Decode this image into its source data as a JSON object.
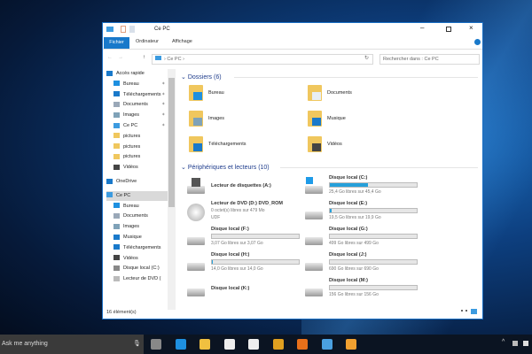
{
  "window": {
    "title": "Ce PC",
    "tabs": [
      "Fichier",
      "Ordinateur",
      "Affichage"
    ],
    "address": "Ce PC",
    "search_placeholder": "Rechercher dans : Ce PC",
    "status": "16 élément(s)"
  },
  "sidebar": [
    {
      "label": "Accès rapide",
      "icon": "star-icon",
      "color": "#1979ca",
      "indent": 0
    },
    {
      "label": "Bureau",
      "icon": "desktop-icon",
      "color": "#1e90e0",
      "indent": 1,
      "pin": true
    },
    {
      "label": "Téléchargements",
      "icon": "download-icon",
      "color": "#1979ca",
      "indent": 1,
      "pin": true
    },
    {
      "label": "Documents",
      "icon": "document-icon",
      "color": "#9aa8b8",
      "indent": 1,
      "pin": true
    },
    {
      "label": "Images",
      "icon": "image-icon",
      "color": "#7fa2b8",
      "indent": 1,
      "pin": true
    },
    {
      "label": "Ce PC",
      "icon": "computer-icon",
      "color": "#3c9be0",
      "indent": 1,
      "pin": true
    },
    {
      "label": "pictures",
      "icon": "folder-icon",
      "color": "#f0c75e",
      "indent": 1
    },
    {
      "label": "pictures",
      "icon": "folder-icon",
      "color": "#f0c75e",
      "indent": 1
    },
    {
      "label": "pictures",
      "icon": "folder-icon",
      "color": "#f0c75e",
      "indent": 1
    },
    {
      "label": "Vidéos",
      "icon": "video-icon",
      "color": "#444",
      "indent": 1
    },
    {
      "label": "OneDrive",
      "icon": "cloud-icon",
      "color": "#1979ca",
      "indent": 0,
      "gap": true
    },
    {
      "label": "Ce PC",
      "icon": "computer-icon",
      "color": "#3c9be0",
      "indent": 0,
      "gap": true,
      "selected": true
    },
    {
      "label": "Bureau",
      "icon": "desktop-icon",
      "color": "#1e90e0",
      "indent": 1
    },
    {
      "label": "Documents",
      "icon": "document-icon",
      "color": "#9aa8b8",
      "indent": 1
    },
    {
      "label": "Images",
      "icon": "image-icon",
      "color": "#7fa2b8",
      "indent": 1
    },
    {
      "label": "Musique",
      "icon": "music-icon",
      "color": "#1979ca",
      "indent": 1
    },
    {
      "label": "Téléchargements",
      "icon": "download-icon",
      "color": "#1979ca",
      "indent": 1
    },
    {
      "label": "Vidéos",
      "icon": "video-icon",
      "color": "#444",
      "indent": 1
    },
    {
      "label": "Disque local (C:)",
      "icon": "drive-icon",
      "color": "#888",
      "indent": 1
    },
    {
      "label": "Lecteur de DVD (",
      "icon": "dvd-icon",
      "color": "#bbb",
      "indent": 1
    }
  ],
  "folders": {
    "header": "Dossiers (6)",
    "items": [
      {
        "label": "Bureau",
        "accent": "#1e90e0"
      },
      {
        "label": "Documents",
        "accent": "#e8eef4"
      },
      {
        "label": "Images",
        "accent": "#7fa2b8"
      },
      {
        "label": "Musique",
        "accent": "#1979ca"
      },
      {
        "label": "Téléchargements",
        "accent": "#1979ca"
      },
      {
        "label": "Vidéos",
        "accent": "#444"
      }
    ]
  },
  "devices": {
    "header": "Périphériques et lecteurs (10)",
    "items": [
      {
        "label": "Lecteur de disquettes (A:)",
        "type": "floppy"
      },
      {
        "label": "Disque local (C:)",
        "type": "system",
        "free": "25,4 Go libres sur 45,4 Go",
        "used_pct": 44
      },
      {
        "label": "Lecteur de DVD (D:) DVD_ROM",
        "type": "dvd",
        "free": "0 octet(s) libres sur 479 Mo",
        "extra": "UDF"
      },
      {
        "label": "Disque local (E:)",
        "type": "drive",
        "free": "19,5 Go libres sur 19,9 Go",
        "used_pct": 2
      },
      {
        "label": "Disque local (F:)",
        "type": "drive",
        "free": "3,07 Go libres sur 3,07 Go",
        "used_pct": 0
      },
      {
        "label": "Disque local (G:)",
        "type": "drive",
        "free": "499 Go libres sur 499 Go",
        "used_pct": 0
      },
      {
        "label": "Disque local (H:)",
        "type": "drive",
        "free": "14,0 Go libres sur 14,0 Go",
        "used_pct": 1
      },
      {
        "label": "Disque local (J:)",
        "type": "drive",
        "free": "690 Go libres sur 690 Go",
        "used_pct": 0
      },
      {
        "label": "Disque local (K:)",
        "type": "drive"
      },
      {
        "label": "Disque local (M:)",
        "type": "drive",
        "free": "156 Go libres sur 156 Go",
        "used_pct": 0
      }
    ]
  },
  "taskbar": {
    "search": "Ask me anything",
    "apps": [
      {
        "name": "task-view-icon",
        "color": "#888"
      },
      {
        "name": "edge-icon",
        "color": "#1e90e0"
      },
      {
        "name": "file-explorer-icon",
        "color": "#f0c040"
      },
      {
        "name": "store-icon",
        "color": "#eee"
      },
      {
        "name": "mail-icon",
        "color": "#eee"
      },
      {
        "name": "chrome-icon",
        "color": "#e0a020"
      },
      {
        "name": "firefox-icon",
        "color": "#e8701a"
      },
      {
        "name": "paint-icon",
        "color": "#4aa0e0"
      },
      {
        "name": "bulb-icon",
        "color": "#f0a030"
      }
    ]
  }
}
